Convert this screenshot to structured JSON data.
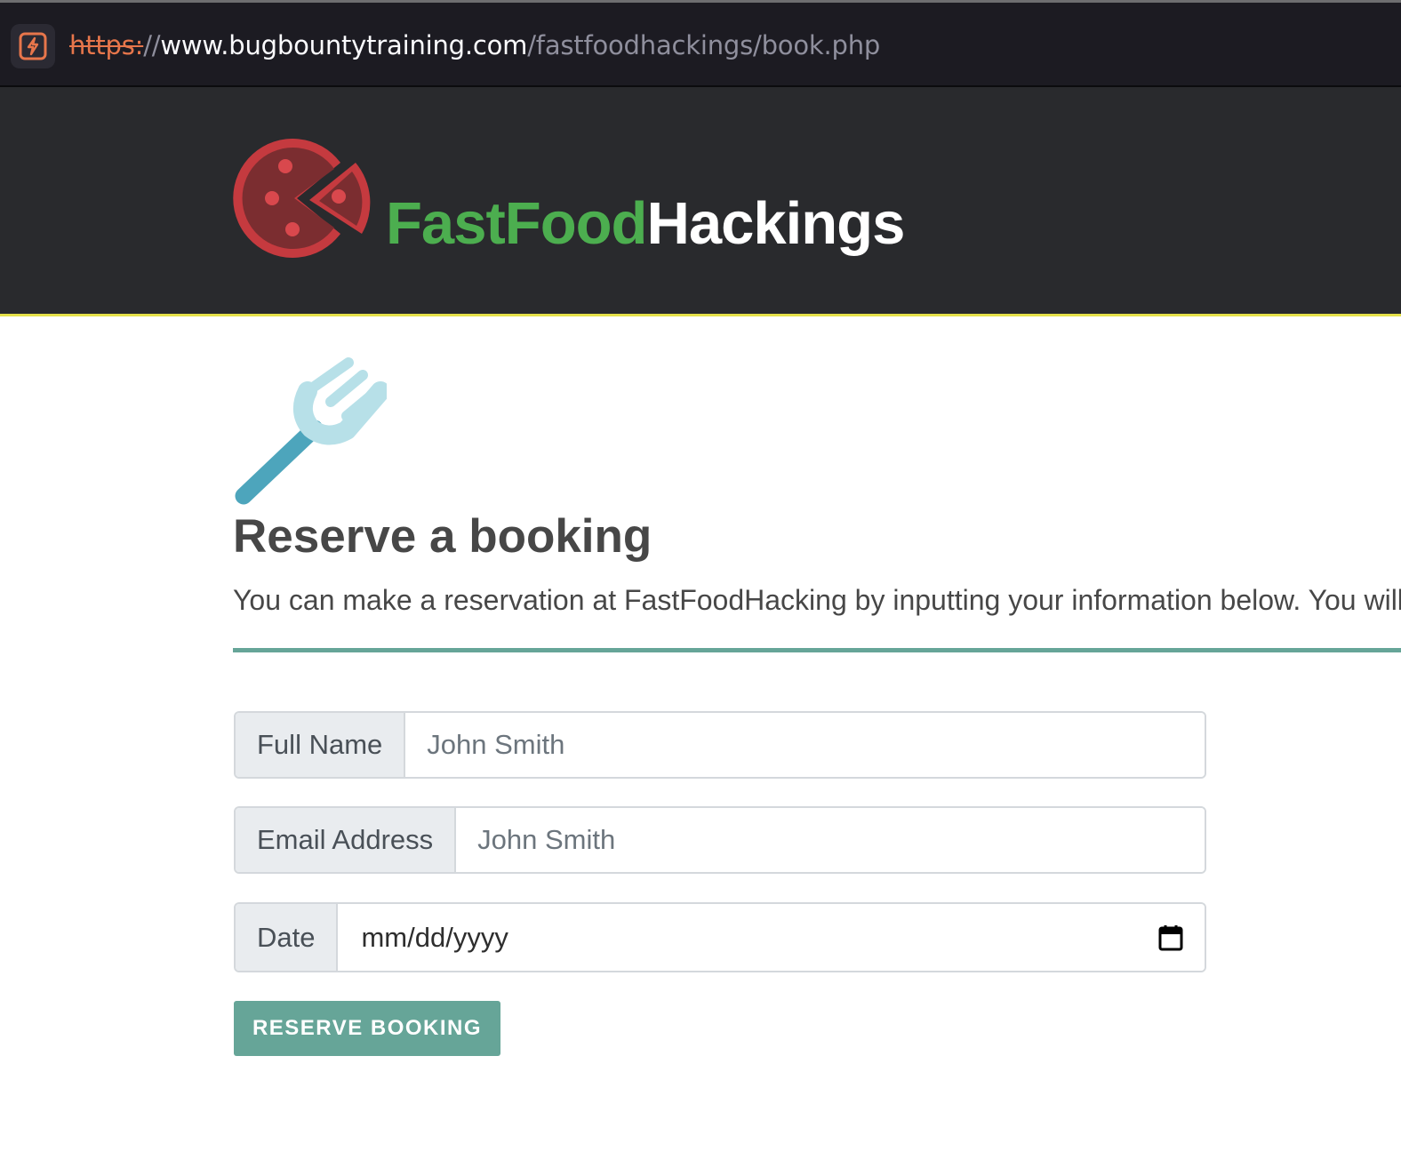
{
  "browser": {
    "url_scheme": "https:",
    "url_sep": "//",
    "url_host": "www.bugbountytraining.com",
    "url_path": "/fastfoodhackings/book.php",
    "security_icon": "insecure-lock-icon"
  },
  "header": {
    "brand_part1": "FastFood",
    "brand_part2": "Hackings",
    "logo_icon": "pizza-logo-icon",
    "colors": {
      "brand_green": "#4cae4f",
      "header_bg": "#292a2d",
      "accent_line": "#e5e14a"
    }
  },
  "main": {
    "hero_icon": "fork-icon",
    "title": "Reserve a booking",
    "intro": "You can make a reservation at FastFoodHacking by inputting your information below. You will"
  },
  "form": {
    "full_name_label": "Full Name",
    "full_name_placeholder": "John Smith",
    "email_label": "Email Address",
    "email_placeholder": "John Smith",
    "date_label": "Date",
    "date_placeholder": "mm/dd/yyyy",
    "submit_label": "RESERVE BOOKING",
    "colors": {
      "accent": "#66a598"
    }
  }
}
